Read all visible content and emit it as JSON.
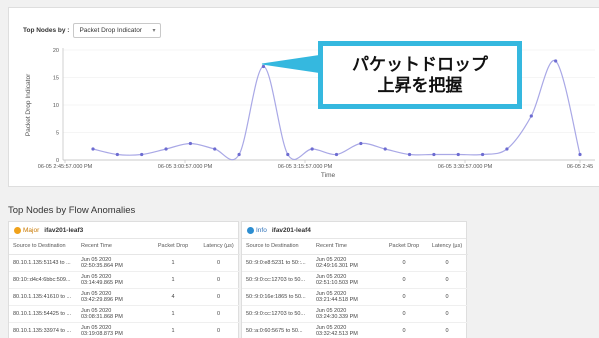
{
  "filter": {
    "label": "Top Nodes by :",
    "value": "Packet Drop Indicator"
  },
  "chart_data": {
    "type": "line",
    "ylabel": "Packet Drop Indicator",
    "xlabel": "Time",
    "ylim": [
      0,
      20
    ],
    "yticks": [
      0,
      5,
      10,
      15,
      20
    ],
    "xticks": [
      "06-05 2:45:57.000 PM",
      "06-05 3:00:57.000 PM",
      "06-05 3:15:57.000 PM",
      "06-05 3:30:57.000 PM",
      "06-05 2:45"
    ],
    "series": [
      {
        "values": [
          2,
          1,
          1,
          2,
          3,
          2,
          1,
          17,
          1,
          2,
          1,
          3,
          2,
          1,
          1,
          1,
          1,
          2,
          8,
          18,
          1
        ]
      }
    ],
    "grid": true,
    "colors": {
      "line": "#a9a8e6",
      "point": "#6d6cd1"
    }
  },
  "callout": {
    "line1": "パケットドロップ",
    "line2": "上昇を把握"
  },
  "section_title": "Top Nodes by Flow Anomalies",
  "cards": [
    {
      "severity": "Major",
      "node": "ifav201-leaf3",
      "headers": [
        "Source to Destination",
        "Recent Time",
        "Packet Drop",
        "Latency (µs)"
      ],
      "rows": [
        {
          "src": "80.10.1.135:51143 to ...",
          "d1": "Jun 05 2020",
          "d2": "02:50:35.864 PM",
          "drop": "1",
          "lat": "0"
        },
        {
          "src": "80:10::d4c4:6bbc:509...",
          "d1": "Jun 05 2020",
          "d2": "03:14:49.865 PM",
          "drop": "1",
          "lat": "0"
        },
        {
          "src": "80.10.1.135:41610 to ...",
          "d1": "Jun 05 2020",
          "d2": "03:42:29.896 PM",
          "drop": "4",
          "lat": "0"
        },
        {
          "src": "80.10.1.135:54425 to ...",
          "d1": "Jun 05 2020",
          "d2": "03:08:31.868 PM",
          "drop": "1",
          "lat": "0"
        },
        {
          "src": "80.10.1.135:33974 to ...",
          "d1": "Jun 05 2020",
          "d2": "03:19:08.873 PM",
          "drop": "1",
          "lat": "0"
        }
      ]
    },
    {
      "severity": "Info",
      "node": "ifav201-leaf4",
      "headers": [
        "Source to Destination",
        "Recent Time",
        "Packet Drop",
        "Latency (µs)"
      ],
      "rows": [
        {
          "src": "50::9:0:e8:5231 to 50::...",
          "d1": "Jun 05 2020",
          "d2": "02:49:16.301 PM",
          "drop": "0",
          "lat": "0"
        },
        {
          "src": "50::9:0:cc:12703 to 50...",
          "d1": "Jun 05 2020",
          "d2": "02:51:10.503 PM",
          "drop": "0",
          "lat": "0"
        },
        {
          "src": "50::9:0:16e:1865 to 50...",
          "d1": "Jun 05 2020",
          "d2": "03:21:44.518 PM",
          "drop": "0",
          "lat": "0"
        },
        {
          "src": "50::9:0:cc:12703 to 50...",
          "d1": "Jun 05 2020",
          "d2": "03:24:30.339 PM",
          "drop": "0",
          "lat": "0"
        },
        {
          "src": "50::a:0:60:5675 to 50...",
          "d1": "Jun 05 2020",
          "d2": "03:32:42.513 PM",
          "drop": "0",
          "lat": "0"
        }
      ]
    }
  ]
}
